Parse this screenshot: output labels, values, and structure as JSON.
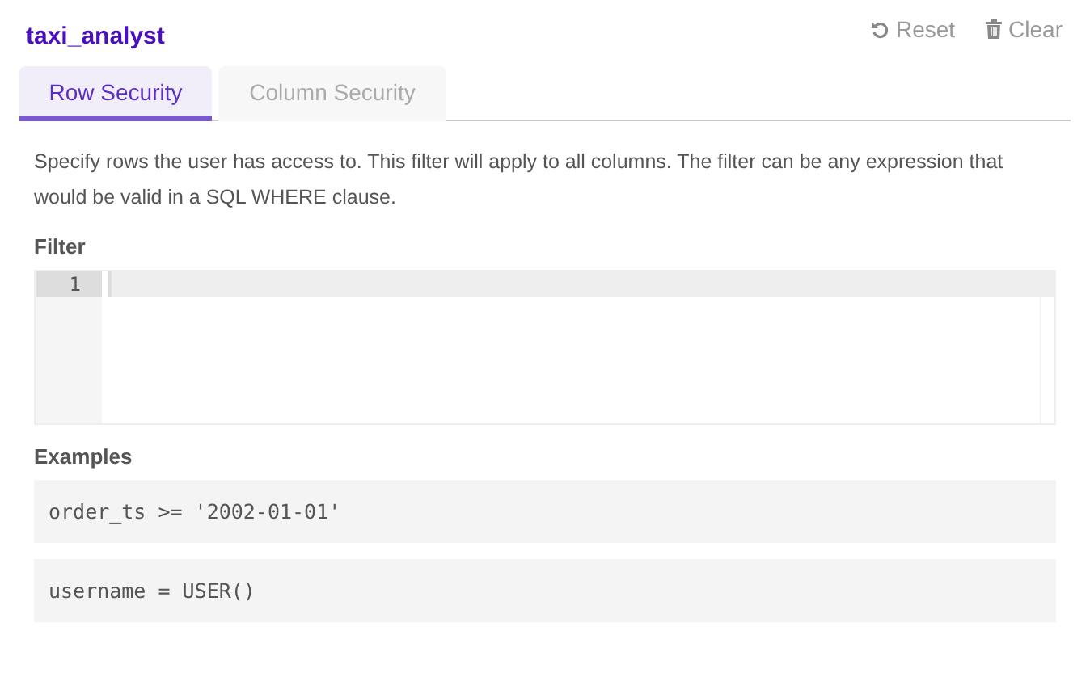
{
  "header": {
    "title": "taxi_analyst",
    "actions": [
      {
        "kind": "reset",
        "label": "Reset"
      },
      {
        "kind": "clear",
        "label": "Clear"
      }
    ]
  },
  "tabs": [
    {
      "label": "Row Security",
      "selected": true
    },
    {
      "label": "Column Security",
      "selected": false
    }
  ],
  "description": "Specify rows the user has access to. This filter will apply to all columns. The filter can be any expression that would be valid in a SQL WHERE clause.",
  "filter": {
    "label": "Filter",
    "line_numbers": [
      "1"
    ]
  },
  "examples": {
    "label": "Examples",
    "items": [
      "order_ts >= '2002-01-01'",
      "username = USER()"
    ]
  }
}
